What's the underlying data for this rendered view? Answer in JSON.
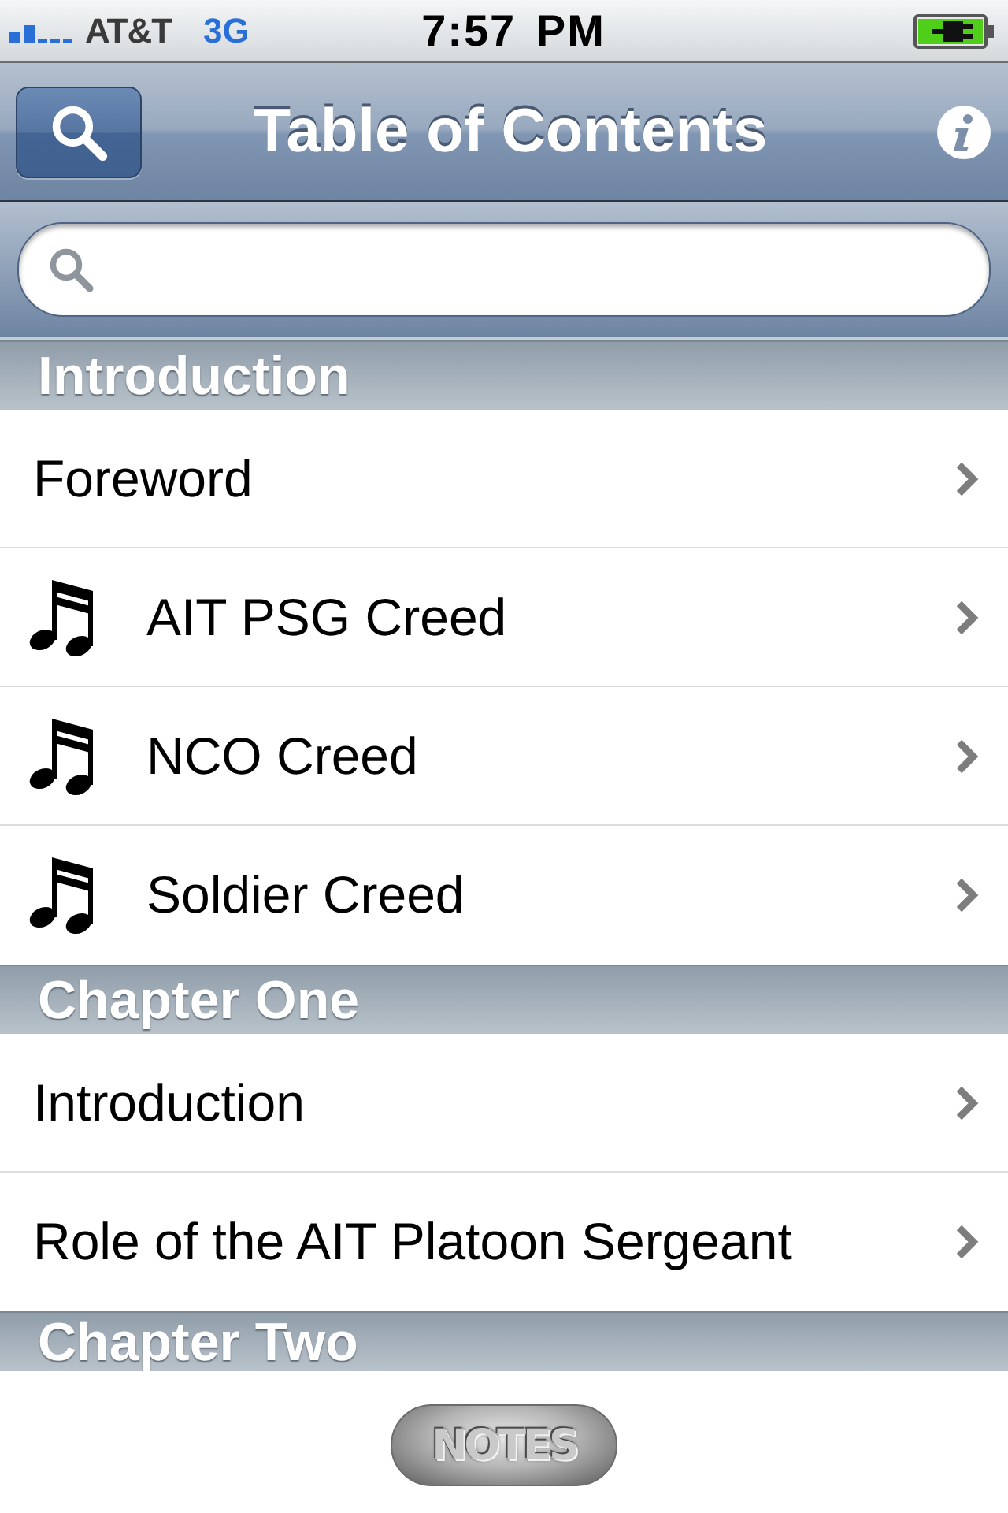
{
  "status_bar": {
    "carrier": "AT&T",
    "network": "3G",
    "time": "7:57 PM"
  },
  "nav_bar": {
    "title": "Table of Contents"
  },
  "sections": [
    {
      "title": "Introduction",
      "items": [
        {
          "label": "Foreword",
          "kind": "plain"
        },
        {
          "label": "AIT PSG Creed",
          "kind": "audio"
        },
        {
          "label": "NCO Creed",
          "kind": "audio"
        },
        {
          "label": "Soldier Creed",
          "kind": "audio"
        }
      ]
    },
    {
      "title": "Chapter One",
      "items": [
        {
          "label": "Introduction",
          "kind": "plain"
        },
        {
          "label": "Role of the AIT Platoon Sergeant",
          "kind": "plain"
        }
      ]
    },
    {
      "title": "Chapter Two"
    }
  ],
  "toolbar": {
    "button": "NOTES"
  }
}
